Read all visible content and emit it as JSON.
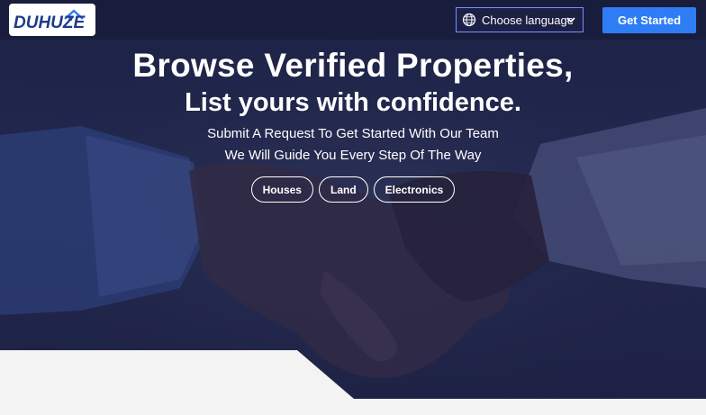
{
  "header": {
    "logo_text": "DUHUZE",
    "language_label": "Choose language",
    "cta_label": "Get Started"
  },
  "hero": {
    "title": "Browse Verified Properties,",
    "subtitle": "List yours with confidence.",
    "tagline_1": "Submit A Request To Get Started With Our Team",
    "tagline_2": "We Will Guide You Every Step Of The Way",
    "categories": [
      "Houses",
      "Land",
      "Electronics"
    ]
  },
  "colors": {
    "overlay": "#1f2448",
    "cta": "#2f7df4",
    "accent_border": "#7a8cff",
    "panel": "#f3f3f3"
  },
  "icons": [
    "logo-house-icon",
    "globe-icon",
    "chevron-down-icon"
  ]
}
